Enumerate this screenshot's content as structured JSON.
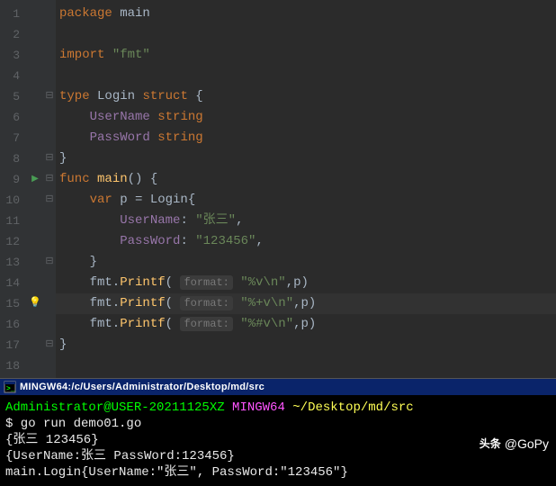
{
  "editor": {
    "lines": [
      {
        "n": 1,
        "mark": "",
        "fold": "",
        "segments": [
          [
            "kw",
            "package "
          ],
          [
            "pkg",
            "main"
          ]
        ]
      },
      {
        "n": 2,
        "mark": "",
        "fold": "",
        "segments": []
      },
      {
        "n": 3,
        "mark": "",
        "fold": "",
        "segments": [
          [
            "kw",
            "import "
          ],
          [
            "str",
            "\"fmt\""
          ]
        ]
      },
      {
        "n": 4,
        "mark": "",
        "fold": "",
        "segments": []
      },
      {
        "n": 5,
        "mark": "",
        "fold": "⊟",
        "segments": [
          [
            "kw",
            "type "
          ],
          [
            "typ",
            "Login "
          ],
          [
            "kw",
            "struct "
          ],
          [
            "white",
            "{"
          ]
        ]
      },
      {
        "n": 6,
        "mark": "",
        "fold": "",
        "segments": [
          [
            "white",
            "    "
          ],
          [
            "field",
            "UserName "
          ],
          [
            "kw",
            "string"
          ]
        ]
      },
      {
        "n": 7,
        "mark": "",
        "fold": "",
        "segments": [
          [
            "white",
            "    "
          ],
          [
            "field",
            "PassWord "
          ],
          [
            "kw",
            "string"
          ]
        ]
      },
      {
        "n": 8,
        "mark": "",
        "fold": "⊟",
        "segments": [
          [
            "white",
            "}"
          ]
        ]
      },
      {
        "n": 9,
        "mark": "▶",
        "fold": "⊟",
        "segments": [
          [
            "kw",
            "func "
          ],
          [
            "fn",
            "main"
          ],
          [
            "white",
            "() {"
          ]
        ]
      },
      {
        "n": 10,
        "mark": "",
        "fold": "⊟",
        "segments": [
          [
            "white",
            "    "
          ],
          [
            "kw",
            "var "
          ],
          [
            "ident",
            "p = Login{"
          ]
        ]
      },
      {
        "n": 11,
        "mark": "",
        "fold": "",
        "segments": [
          [
            "white",
            "        "
          ],
          [
            "field",
            "UserName"
          ],
          [
            "white",
            ": "
          ],
          [
            "str",
            "\"张三\""
          ],
          [
            "white",
            ","
          ]
        ]
      },
      {
        "n": 12,
        "mark": "",
        "fold": "",
        "segments": [
          [
            "white",
            "        "
          ],
          [
            "field",
            "PassWord"
          ],
          [
            "white",
            ": "
          ],
          [
            "str",
            "\"123456\""
          ],
          [
            "white",
            ","
          ]
        ]
      },
      {
        "n": 13,
        "mark": "",
        "fold": "⊟",
        "segments": [
          [
            "white",
            "    }"
          ]
        ]
      },
      {
        "n": 14,
        "mark": "",
        "fold": "",
        "segments": [
          [
            "white",
            "    fmt."
          ],
          [
            "fn",
            "Printf"
          ],
          [
            "white",
            "( "
          ],
          [
            "hint",
            "format:"
          ],
          [
            "white",
            " "
          ],
          [
            "str",
            "\"%v\\n\""
          ],
          [
            "white",
            ",p)"
          ]
        ]
      },
      {
        "n": 15,
        "mark": "💡",
        "fold": "",
        "hl": true,
        "segments": [
          [
            "white",
            "    fmt."
          ],
          [
            "fn",
            "Printf"
          ],
          [
            "white",
            "( "
          ],
          [
            "hint",
            "format:"
          ],
          [
            "white",
            " "
          ],
          [
            "str",
            "\"%+v\\n\""
          ],
          [
            "white",
            ",p)"
          ]
        ]
      },
      {
        "n": 16,
        "mark": "",
        "fold": "",
        "segments": [
          [
            "white",
            "    fmt."
          ],
          [
            "fn",
            "Printf"
          ],
          [
            "white",
            "( "
          ],
          [
            "hint",
            "format:"
          ],
          [
            "white",
            " "
          ],
          [
            "str",
            "\"%#v\\n\""
          ],
          [
            "white",
            ",p)"
          ]
        ]
      },
      {
        "n": 17,
        "mark": "",
        "fold": "⊟",
        "segments": [
          [
            "white",
            "}"
          ]
        ]
      },
      {
        "n": 18,
        "mark": "",
        "fold": "",
        "segments": []
      }
    ],
    "highlight_line": 15
  },
  "terminal": {
    "title": "MINGW64:/c/Users/Administrator/Desktop/md/src",
    "icon": "terminal-icon",
    "prompt_user": "Administrator@USER-20211125XZ",
    "prompt_env": "MINGW64",
    "prompt_path": "~/Desktop/md/src",
    "command": "$ go run demo01.go",
    "output": [
      "{张三 123456}",
      "{UserName:张三 PassWord:123456}",
      "main.Login{UserName:\"张三\", PassWord:\"123456\"}"
    ]
  },
  "watermark": {
    "brand": "头条",
    "handle": "@GoPy"
  }
}
